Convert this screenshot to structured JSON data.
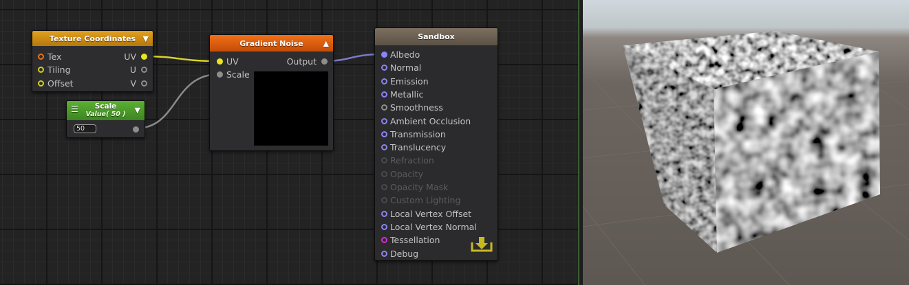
{
  "nodes": {
    "texture_coords": {
      "title": "Texture Coordinates",
      "inputs": [
        "Tex",
        "Tiling",
        "Offset"
      ],
      "outputs": [
        "UV",
        "U",
        "V"
      ]
    },
    "scale": {
      "title": "Scale",
      "subtitle": "Value( 50 )",
      "value": "50"
    },
    "gradient_noise": {
      "title": "Gradient Noise",
      "inputs": [
        "UV",
        "Scale"
      ],
      "output": "Output"
    },
    "sandbox": {
      "title": "Sandbox",
      "inputs": [
        {
          "label": "Albedo",
          "state": "connected"
        },
        {
          "label": "Normal",
          "state": "active"
        },
        {
          "label": "Emission",
          "state": "active"
        },
        {
          "label": "Metallic",
          "state": "active"
        },
        {
          "label": "Smoothness",
          "state": "gray"
        },
        {
          "label": "Ambient Occlusion",
          "state": "active"
        },
        {
          "label": "Transmission",
          "state": "active"
        },
        {
          "label": "Translucency",
          "state": "active"
        },
        {
          "label": "Refraction",
          "state": "disabled"
        },
        {
          "label": "Opacity",
          "state": "disabled"
        },
        {
          "label": "Opacity Mask",
          "state": "disabled"
        },
        {
          "label": "Custom Lighting",
          "state": "disabled"
        },
        {
          "label": "Local Vertex Offset",
          "state": "active"
        },
        {
          "label": "Local Vertex Normal",
          "state": "active"
        },
        {
          "label": "Tessellation",
          "state": "special"
        },
        {
          "label": "Debug",
          "state": "active"
        }
      ]
    }
  },
  "colors": {
    "texture_header": "#c98a0c",
    "scale_header": "#4a9a28",
    "noise_header": "#e0600c",
    "sandbox_header": "#6e6356",
    "wire_yellow": "#d8d42a",
    "wire_gray": "#8a8a8a",
    "wire_blue": "#7d78c8"
  },
  "icons": {
    "node_menu": "triangle-down-icon",
    "noise_collapse": "triangle-up-icon",
    "scale_menu": "hamburger-icon",
    "master_output": "download-tray-icon"
  }
}
